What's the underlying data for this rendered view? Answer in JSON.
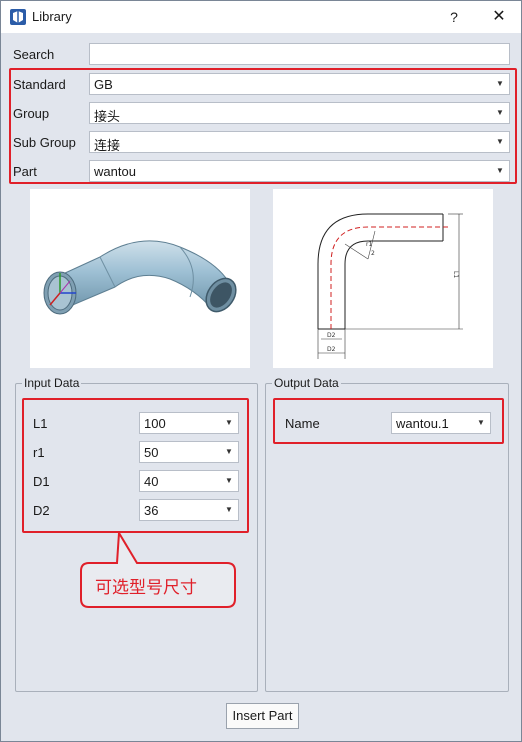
{
  "window": {
    "title": "Library",
    "help_label": "?",
    "close_label": "✕"
  },
  "search": {
    "label": "Search",
    "value": ""
  },
  "selectors": [
    {
      "label": "Standard",
      "value": "GB"
    },
    {
      "label": "Group",
      "value": "接头"
    },
    {
      "label": "Sub Group",
      "value": "连接"
    },
    {
      "label": "Part",
      "value": "wantou"
    }
  ],
  "drawing": {
    "label_r1": "r1",
    "label_r2": "2",
    "label_l1": "L1",
    "label_d2": "D2",
    "label_d2b": "D2"
  },
  "input_data": {
    "title": "Input Data",
    "fields": [
      {
        "label": "L1",
        "value": "100"
      },
      {
        "label": "r1",
        "value": "50"
      },
      {
        "label": "D1",
        "value": "40"
      },
      {
        "label": "D2",
        "value": "36"
      }
    ]
  },
  "annotation": {
    "text": "可选型号尺寸"
  },
  "output_data": {
    "title": "Output Data",
    "name_label": "Name",
    "name_value": "wantou.1"
  },
  "footer": {
    "insert_label": "Insert Part"
  },
  "colors": {
    "highlight": "#e0202a",
    "window_bg": "#e1e5ed",
    "pipe": "#8fb3c8"
  }
}
